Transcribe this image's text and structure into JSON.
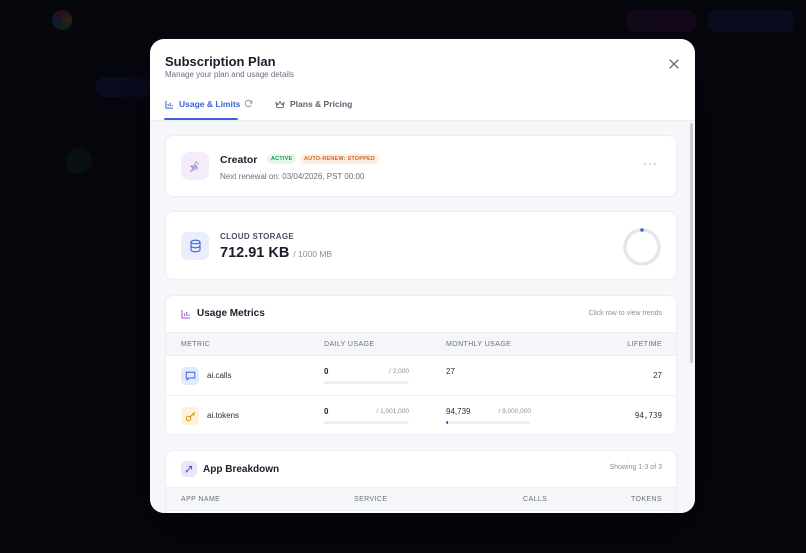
{
  "modal": {
    "title": "Subscription Plan",
    "subtitle": "Manage your plan and usage details"
  },
  "tabs": [
    {
      "label": "Usage & Limits",
      "active": true
    },
    {
      "label": "Plans & Pricing",
      "active": false
    }
  ],
  "plan": {
    "name": "Creator",
    "status_badge": "ACTIVE",
    "renew_badge": "AUTO-RENEW: STOPPED",
    "renewal": "Next renewal on: 03/04/2026, PST 00:00",
    "more": "···"
  },
  "storage": {
    "label": "CLOUD STORAGE",
    "value": "712.91 KB",
    "limit": "/ 1000 MB",
    "fraction_used": 0.0007
  },
  "metrics": {
    "title": "Usage Metrics",
    "hint": "Click row to view trends",
    "headers": [
      "METRIC",
      "DAILY USAGE",
      "MONTHLY USAGE",
      "LIFETIME"
    ],
    "rows": [
      {
        "name": "ai.calls",
        "icon": "chat-bubble-icon",
        "daily": "0",
        "daily_limit": "/ 2,000",
        "daily_fraction": 0,
        "monthly": "27",
        "monthly_limit": "",
        "monthly_fraction": null,
        "lifetime": "27"
      },
      {
        "name": "ai.tokens",
        "icon": "key-icon",
        "daily": "0",
        "daily_limit": "/ 1,001,000",
        "daily_fraction": 0,
        "monthly": "94,739",
        "monthly_limit": "/ 9,000,000",
        "monthly_fraction": 0.0105,
        "lifetime": "94,739"
      }
    ]
  },
  "apps": {
    "title": "App Breakdown",
    "hint": "Showing 1-3 of 3",
    "headers": [
      "APP NAME",
      "SERVICE",
      "CALLS",
      "TOKENS"
    ]
  },
  "colors": {
    "accent": "#3b63d6",
    "active_badge": "#1f9d50",
    "renew_badge": "#d0662a"
  }
}
